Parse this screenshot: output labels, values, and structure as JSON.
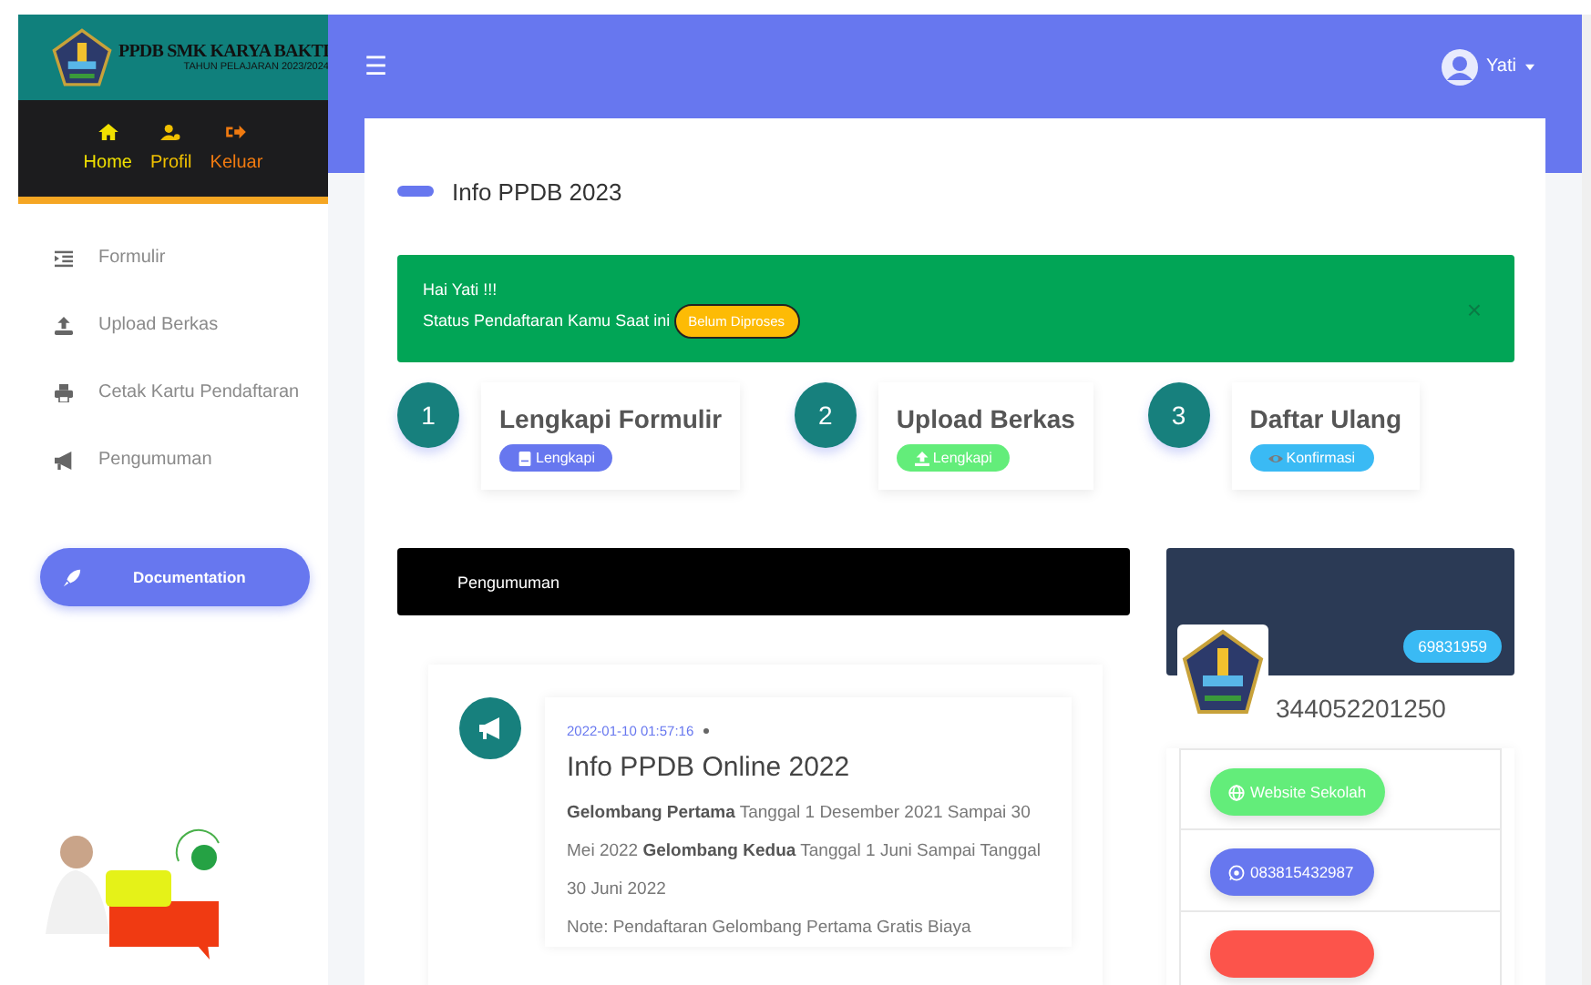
{
  "brand": {
    "title": "PPDB SMK KARYA BAKTI",
    "subtitle": "TAHUN PELAJARAN 2023/2024"
  },
  "top_nav": [
    {
      "label": "Home",
      "color": "#f0e000"
    },
    {
      "label": "Profil",
      "color": "#f0c000"
    },
    {
      "label": "Keluar",
      "color": "#f07a10"
    }
  ],
  "sidebar": {
    "items": [
      {
        "label": "Formulir"
      },
      {
        "label": "Upload Berkas"
      },
      {
        "label": "Cetak Kartu Pendaftaran"
      },
      {
        "label": "Pengumuman"
      }
    ],
    "doc_button": "Documentation"
  },
  "navbar": {
    "menu_icon": "☰",
    "user": "Yati"
  },
  "page_title": "Info PPDB 2023",
  "alert": {
    "greeting": "Hai Yati !!!",
    "status_label": "Status Pendaftaran Kamu Saat ini",
    "status": "Belum Diproses",
    "close": "×"
  },
  "steps": [
    {
      "number": "1",
      "title": "Lengkapi Formulir",
      "button": "Lengkapi",
      "color": "#6777ef"
    },
    {
      "number": "2",
      "title": "Upload Berkas",
      "button": "Lengkapi",
      "color": "#63ed7a"
    },
    {
      "number": "3",
      "title": "Daftar Ulang",
      "button": "Konfirmasi",
      "color": "#3abaf4"
    }
  ],
  "announcements": {
    "header": "Pengumuman",
    "items": [
      {
        "date": "2022-01-10 01:57:16",
        "title": "Info PPDB Online 2022",
        "body": "**Gelombang Pertama** Tanggal 1 Desember 2021 Sampai 30 Mei 2022 **Gelombang Kedua** Tanggal 1 Juni Sampai Tanggal 30 Juni 2022",
        "note": "Note: Pendaftaran Gelombang Pertama Gratis Biaya"
      }
    ]
  },
  "profile": {
    "badge": "69831959",
    "npsn": "344052201250",
    "links": [
      {
        "label": "Website Sekolah",
        "color": "#63ed7a"
      },
      {
        "label": "083815432987",
        "color": "#6777ef"
      },
      {
        "color": "#fc544b"
      }
    ]
  }
}
